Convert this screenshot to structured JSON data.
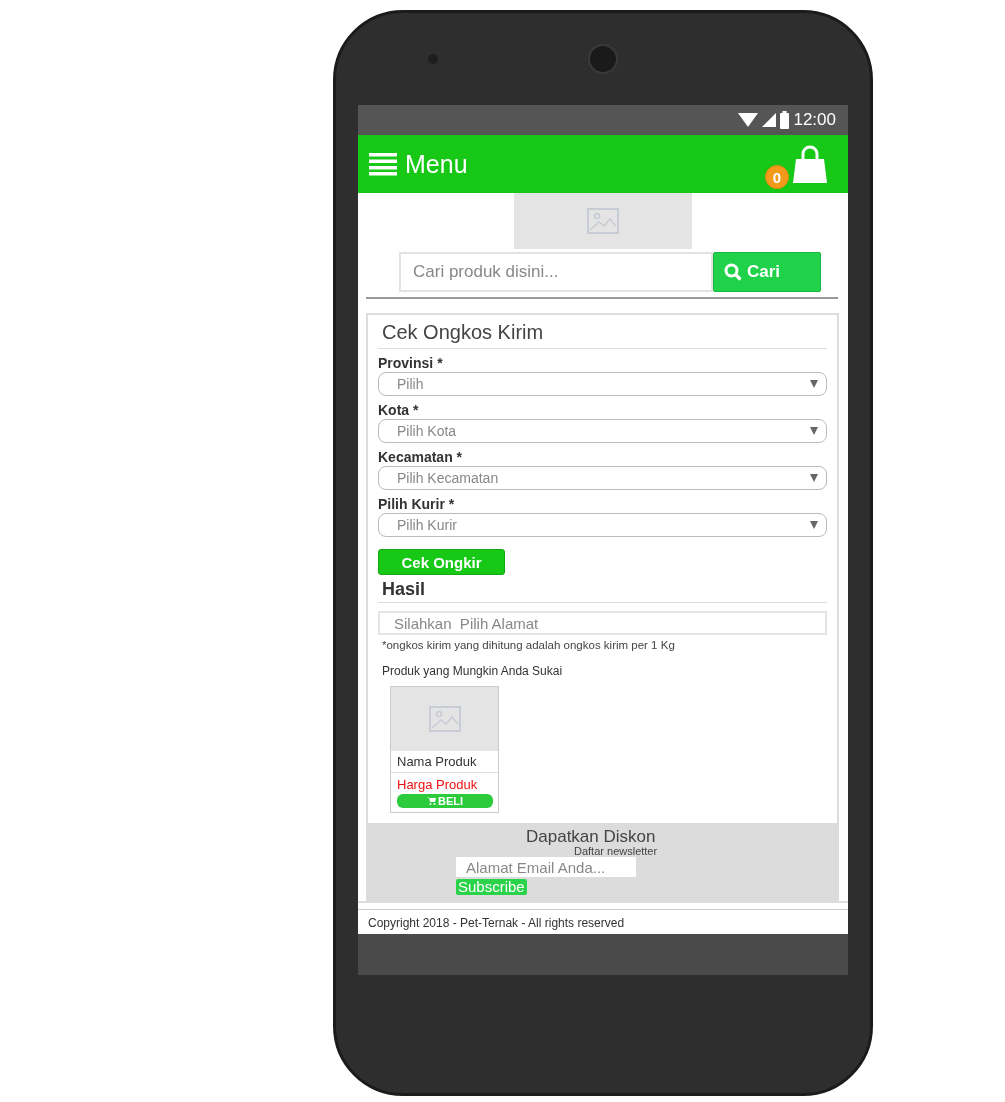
{
  "status_bar": {
    "time": "12:00"
  },
  "app_bar": {
    "title": "Menu",
    "cart_count": "0"
  },
  "search": {
    "placeholder": "Cari produk disini...",
    "button": "Cari"
  },
  "shipping_form": {
    "title": "Cek Ongkos Kirim",
    "fields": [
      {
        "label": "Provinsi *",
        "value": "Pilih"
      },
      {
        "label": "Kota *",
        "value": "Pilih Kota"
      },
      {
        "label": "Kecamatan *",
        "value": "Pilih Kecamatan"
      },
      {
        "label": "Pilih Kurir *",
        "value": "Pilih Kurir"
      }
    ],
    "button": "Cek Ongkir",
    "result_title": "Hasil",
    "result_placeholder": "Silahkan  Pilih Alamat",
    "note": "*ongkos kirim yang dihitung adalah ongkos kirim per 1 Kg"
  },
  "recommendations": {
    "title": "Produk yang Mungkin Anda Sukai",
    "products": [
      {
        "name": "Nama Produk",
        "price": "Harga Produk",
        "button": "BELI"
      }
    ]
  },
  "newsletter": {
    "title": "Dapatkan Diskon",
    "subtitle": "Daftar newsletter",
    "placeholder": "Alamat Email Anda...",
    "button": "Subscribe"
  },
  "footer": {
    "copyright": "Copyright 2018 - Pet-Ternak - All rights reserved"
  }
}
